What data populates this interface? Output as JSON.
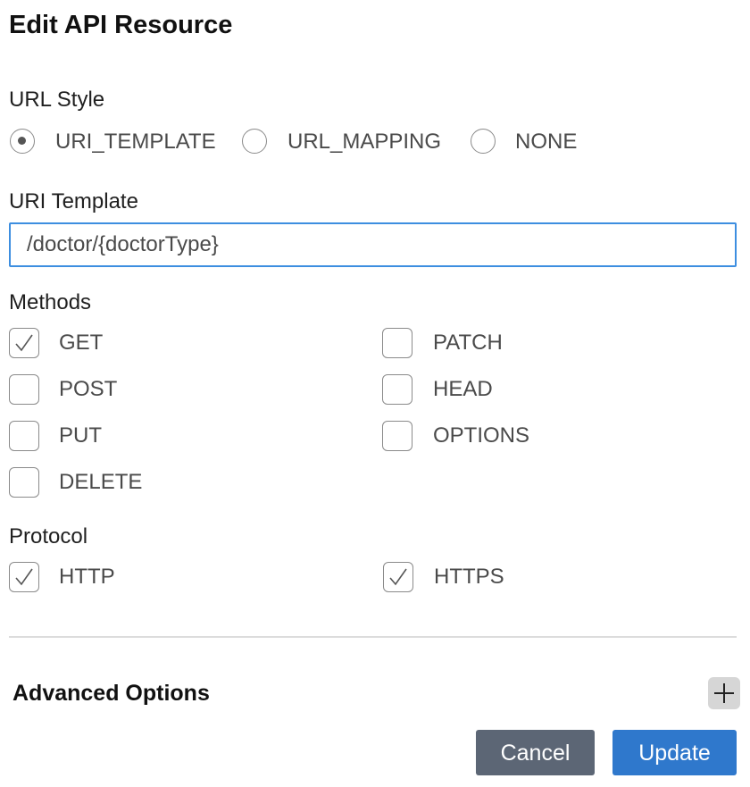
{
  "dialog": {
    "title": "Edit API Resource"
  },
  "url_style": {
    "label": "URL Style",
    "options": [
      {
        "label": "URI_TEMPLATE",
        "selected": true
      },
      {
        "label": "URL_MAPPING",
        "selected": false
      },
      {
        "label": "NONE",
        "selected": false
      }
    ]
  },
  "uri_template": {
    "label": "URI Template",
    "value": "/doctor/{doctorType}"
  },
  "methods": {
    "label": "Methods",
    "items": [
      {
        "label": "GET",
        "checked": true
      },
      {
        "label": "PATCH",
        "checked": false
      },
      {
        "label": "POST",
        "checked": false
      },
      {
        "label": "HEAD",
        "checked": false
      },
      {
        "label": "PUT",
        "checked": false
      },
      {
        "label": "OPTIONS",
        "checked": false
      },
      {
        "label": "DELETE",
        "checked": false
      }
    ]
  },
  "protocol": {
    "label": "Protocol",
    "items": [
      {
        "label": "HTTP",
        "checked": true
      },
      {
        "label": "HTTPS",
        "checked": true
      }
    ]
  },
  "advanced": {
    "title": "Advanced Options",
    "toggle_icon": "plus-icon"
  },
  "buttons": {
    "cancel": "Cancel",
    "update": "Update"
  },
  "colors": {
    "accent": "#2f78cc",
    "cancel": "#5c6675",
    "input_border": "#3d8ee0"
  }
}
